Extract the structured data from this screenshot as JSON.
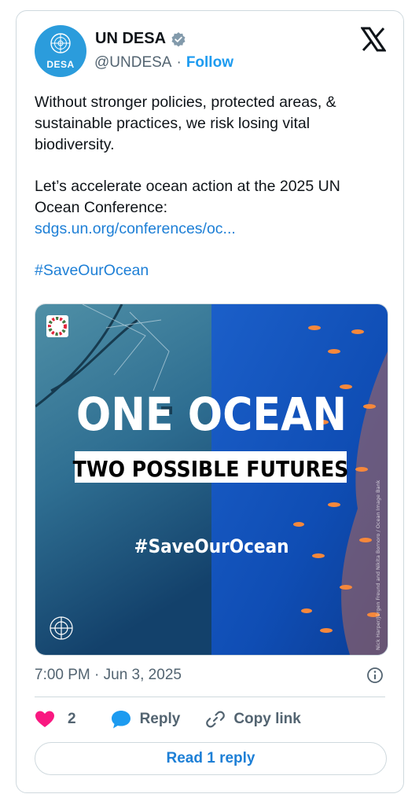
{
  "author": {
    "name": "UN DESA",
    "avatar_label": "DESA",
    "handle": "@UNDESA",
    "separator": "·",
    "follow_label": "Follow"
  },
  "tweet": {
    "para1": "Without stronger policies, protected areas, & sustainable practices, we risk losing vital biodiversity.",
    "para2": "Let’s accelerate ocean action at the 2025 UN Ocean Conference:",
    "link": "sdgs.un.org/conferences/oc...",
    "hashtag": "#SaveOurOcean"
  },
  "media": {
    "headline": "ONE OCEAN",
    "subheadline": "TWO POSSIBLE FUTURES",
    "hashtag": "#SaveOurOcean",
    "credit": "Nick Harper/Jürgen Freund and Nikita Bornoro / Ocean Image Bank"
  },
  "meta": {
    "timestamp": "7:00 PM · Jun 3, 2025"
  },
  "actions": {
    "like_count": "2",
    "reply_label": "Reply",
    "copy_link_label": "Copy link",
    "read_replies_label": "Read 1 reply"
  },
  "colors": {
    "link_blue": "#1d7fd6",
    "follow_blue": "#1d9bf0",
    "like_pink": "#f91880",
    "avatar_blue": "#2b9cdc"
  }
}
